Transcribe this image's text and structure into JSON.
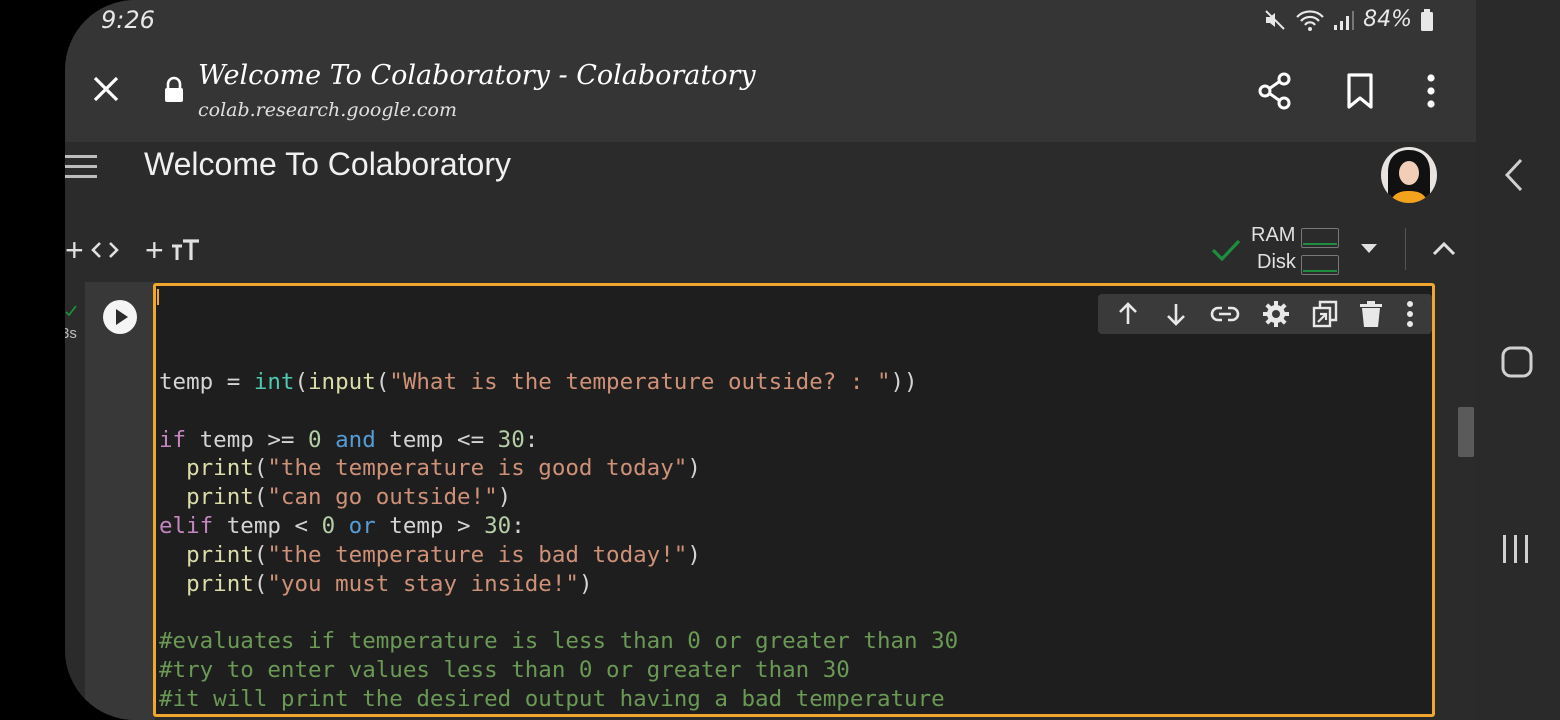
{
  "status_bar": {
    "time": "9:26",
    "battery": "84%"
  },
  "browser": {
    "page_title": "Welcome To Colaboratory - Colaboratory",
    "url": "colab.research.google.com"
  },
  "app": {
    "title": "Welcome To Colaboratory"
  },
  "toolbar": {
    "add_code": "+",
    "add_text": "+",
    "ram_label": "RAM",
    "disk_label": "Disk",
    "status_color": "#1e8e3e"
  },
  "cell": {
    "exec_time": "3s",
    "border_color": "#f0a72e",
    "code_lines": [
      "temp = int(input(\"What is the temperature outside? : \"))",
      "",
      "if temp >= 0 and temp <= 30:",
      "  print(\"the temperature is good today\")",
      "  print(\"can go outside!\")",
      "elif temp < 0 or temp > 30:",
      "  print(\"the temperature is bad today!\")",
      "  print(\"you must stay inside!\")",
      "",
      "#evaluates if temperature is less than 0 or greater than 30",
      "#try to enter values less than 0 or greater than 30",
      "#it will print the desired output having a bad temperature"
    ],
    "toolbar_icons": [
      "move-up-icon",
      "move-down-icon",
      "link-icon",
      "settings-icon",
      "mirror-cell-icon",
      "delete-icon",
      "more-vert-icon"
    ]
  }
}
